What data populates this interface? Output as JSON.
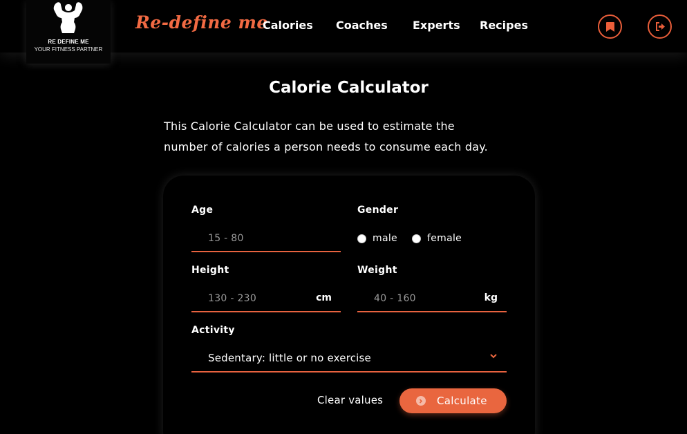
{
  "logo": {
    "title": "RE DEFINE ME",
    "subtitle": "YOUR FITNESS PARTNER",
    "icon": "bodybuilder-icon"
  },
  "brand": "Re-define me",
  "nav": {
    "items": [
      "Calories",
      "Coaches",
      "Experts",
      "Recipes"
    ]
  },
  "header_actions": {
    "bookmark_icon": "bookmark-icon",
    "logout_icon": "logout-icon"
  },
  "page": {
    "title": "Calorie Calculator",
    "intro_line1": "This Calorie Calculator can be used to estimate the",
    "intro_line2": "number of calories a person needs to consume each day."
  },
  "form": {
    "age": {
      "label": "Age",
      "placeholder": "15 - 80"
    },
    "gender": {
      "label": "Gender",
      "options": [
        "male",
        "female"
      ]
    },
    "height": {
      "label": "Height",
      "placeholder": "130 - 230",
      "unit": "cm"
    },
    "weight": {
      "label": "Weight",
      "placeholder": "40 - 160",
      "unit": "kg"
    },
    "activity": {
      "label": "Activity",
      "selected": "Sedentary: little or no exercise"
    },
    "clear_label": "Clear values",
    "calculate_label": "Calculate"
  },
  "colors": {
    "accent": "#e9663f",
    "background": "#000000",
    "text": "#ffffff"
  }
}
